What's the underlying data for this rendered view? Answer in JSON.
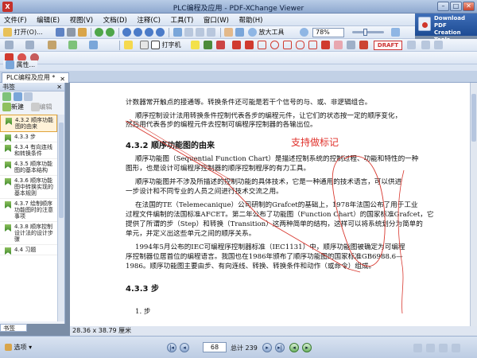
{
  "window": {
    "title": "PLC编程及应用 - PDF-XChange Viewer"
  },
  "menu": [
    "文件(F)",
    "编辑(E)",
    "视图(V)",
    "文档(D)",
    "注释(C)",
    "工具(T)",
    "窗口(W)",
    "帮助(H)"
  ],
  "promo": {
    "line1": "Download PDF",
    "line2": "Creation Tools"
  },
  "toolbar1": {
    "open_label": "打开(O)...",
    "zoom_in_label": "放大工具",
    "zoom_value": "78%"
  },
  "toolbar2": {
    "typewriter_label": "打字机",
    "draft_label": "DRAFT"
  },
  "toolbar3": {
    "properties_label": "属性..."
  },
  "tab": {
    "label": "PLC编程及应用 *"
  },
  "sidebar": {
    "title": "书签",
    "new_label": "新建",
    "edit_label": "编辑",
    "items": [
      "4.3.2 顺序功能图的由来",
      "4.3.3 步",
      "4.3.4 有向连线和转换条件",
      "4.3.5 顺序功能图的基本结构",
      "4.3.6 顺序功能图中转换实现的基本规则",
      "4.3.7 绘制顺序功能图时的注意事项",
      "4.3.8 顺序控制设计法的设计步骤",
      "4.4 习题"
    ],
    "bottom_tab": "书签"
  },
  "document": {
    "p1": "计数器常开触点的接通等。转换条件还可能是若干个信号的与、或、非逻辑组合。",
    "p2a": "顺序控制设计法用转换条件控制代表各步的编程元件，让它们的状态按一定的顺序变化，",
    "p2b": "然后用代表各步的编程元件去控制可编程序控制器的各输出位。",
    "h1": "4.3.2  顺序功能图的由来",
    "annotation": "支持做标记",
    "p3a": "顺序功能图（Sequential Function Chart）是描述控制系统的控制过程、功能和特性的一种",
    "p3b": "图形，也是设计可编程序控制器的顺序控制程序的有力工具。",
    "p4a": "顺序功能图并不涉及所描述的控制功能的具体技术，它是一种通用的技术语言，可以供进",
    "p4b": "一步设计和不同专业的人员之间进行技术交流之用。",
    "p5a": "在法国的TE（Telemecanique）公司研制的Grafcet的基础上，1978年法国公布了用于工业",
    "p5b": "过程文件编制的法国标准AFCET。第二年公布了功能图（Function Chart）的国家标准Grafcet，它",
    "p5c": "提供了所谓的步（Step）和转换（Transition）这两种简单的结构，这样可以将系统划分为简单的",
    "p5d": "单元，并定义出这些单元之间的顺序关系。",
    "p6a": "1994年5月公布的IEC可编程序控制器标准（IEC1131）中，顺序功能图被确定为可编程",
    "p6b": "序控制器位居首位的编程语言。我国也在1986年颁布了顺序功能图的国家标准GB6988.6—",
    "p6c": "1986。顺序功能图主要由步、有向连线、转换、转换条件和动作（或命令）组成。",
    "h2": "4.3.3  步",
    "li1": "1. 步"
  },
  "status": {
    "size": "28.36 x 38.79 厘米",
    "options_label": "选项",
    "page_current": "68",
    "page_total": "总计 239"
  }
}
